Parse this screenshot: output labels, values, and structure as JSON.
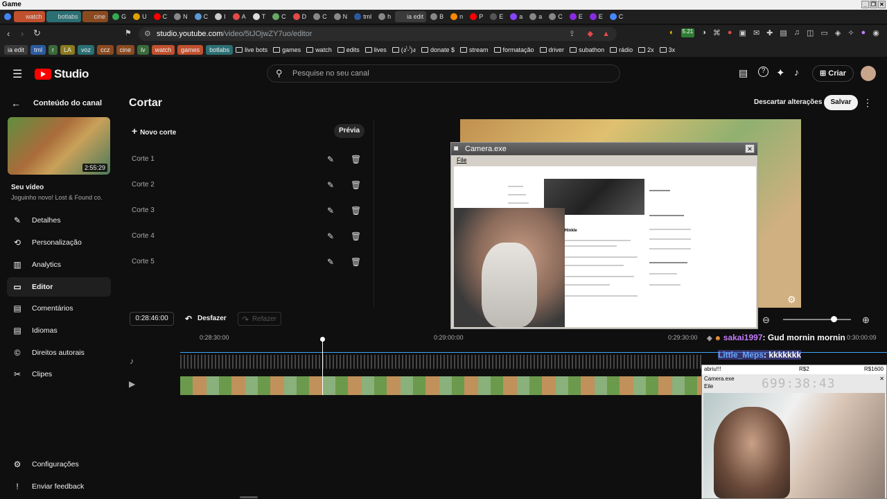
{
  "window": {
    "title": "Game",
    "controls": [
      "_",
      "❐",
      "✕"
    ]
  },
  "tabs": [
    {
      "label": "watch",
      "color": "#c0502e"
    },
    {
      "label": "botlabs",
      "color": "#2b6f73"
    },
    {
      "label": "cine",
      "color": "#8a4a20"
    },
    {
      "label": "G",
      "color": "#34a853"
    },
    {
      "label": "U",
      "color": "#e0a000"
    },
    {
      "label": "C",
      "color": "#ff0000"
    },
    {
      "label": "N",
      "color": "#888888"
    },
    {
      "label": "C",
      "color": "#5a9bd5"
    },
    {
      "label": "I",
      "color": "#cccccc"
    },
    {
      "label": "A",
      "color": "#e24a4a"
    },
    {
      "label": "T",
      "color": "#dddddd"
    },
    {
      "label": "C",
      "color": "#66aa66"
    },
    {
      "label": "D",
      "color": "#e24a4a"
    },
    {
      "label": "C",
      "color": "#888888"
    },
    {
      "label": "N",
      "color": "#888888"
    },
    {
      "label": "tml",
      "color": "#2c5aa0"
    },
    {
      "label": "h",
      "color": "#888888"
    },
    {
      "label": "ia edit",
      "color": "#3a3a3a"
    },
    {
      "label": "B",
      "color": "#888888"
    },
    {
      "label": "n",
      "color": "#ff8800"
    },
    {
      "label": "P",
      "color": "#ff0000"
    },
    {
      "label": "E",
      "color": "#555555"
    },
    {
      "label": "a",
      "color": "#8844ff"
    },
    {
      "label": "a",
      "color": "#888888"
    },
    {
      "label": "C",
      "color": "#888888"
    },
    {
      "label": "E",
      "color": "#8a2be2"
    },
    {
      "label": "E",
      "color": "#8a2be2"
    },
    {
      "label": "C",
      "color": "#4488ff"
    }
  ],
  "address": {
    "host": "studio.youtube.com",
    "path": "/video/5tJOjwZY7uo/editor"
  },
  "bookmarks": {
    "pills": [
      {
        "label": "ia edit",
        "color": "#3a3a3a"
      },
      {
        "label": "tml",
        "color": "#2c5aa0"
      },
      {
        "label": "r",
        "color": "#3a6a3a"
      },
      {
        "label": "LA",
        "color": "#8a7a20"
      },
      {
        "label": "voz",
        "color": "#2b6f73"
      },
      {
        "label": "ccz",
        "color": "#8a4a20"
      },
      {
        "label": "cine",
        "color": "#8a4a20"
      },
      {
        "label": "lv",
        "color": "#3a6a3a"
      },
      {
        "label": "watch",
        "color": "#c0502e"
      },
      {
        "label": "games",
        "color": "#c0502e"
      },
      {
        "label": "botlabs",
        "color": "#2b6f73"
      }
    ],
    "folders": [
      "live bots",
      "games",
      "watch",
      "edits",
      "lives",
      "(ง'̀-'́)ง",
      "donate $",
      "stream",
      "formatação",
      "driver",
      "subathon",
      "rádio",
      "2x",
      "3x"
    ]
  },
  "studio": {
    "brand": "Studio",
    "search_placeholder": "Pesquise no seu canal",
    "create_label": "Criar"
  },
  "sidebar": {
    "back_label": "Conteúdo do canal",
    "thumb_duration": "2:55:29",
    "your_video": "Seu vídeo",
    "video_title": "Joguinho novo! Lost & Found co.",
    "items": [
      {
        "label": "Detalhes",
        "icon": "✎"
      },
      {
        "label": "Personalização",
        "icon": "⟲"
      },
      {
        "label": "Analytics",
        "icon": "▥"
      },
      {
        "label": "Editor",
        "icon": "▭"
      },
      {
        "label": "Comentários",
        "icon": "▤"
      },
      {
        "label": "Idiomas",
        "icon": "▤"
      },
      {
        "label": "Direitos autorais",
        "icon": "©"
      },
      {
        "label": "Clipes",
        "icon": "✂"
      }
    ],
    "footer": [
      {
        "label": "Configurações",
        "icon": "⚙"
      },
      {
        "label": "Enviar feedback",
        "icon": "!"
      }
    ]
  },
  "editor": {
    "title": "Cortar",
    "discard_label": "Descartar alterações",
    "save_label": "Salvar",
    "new_cut_label": "Novo corte",
    "preview_label": "Prévia",
    "cuts": [
      "Corte 1",
      "Corte 2",
      "Corte 3",
      "Corte 4",
      "Corte 5"
    ],
    "timecode": "0:28:46:00",
    "undo_label": "Desfazer",
    "redo_label": "Refazer",
    "ticks": [
      "0:28:30:00",
      "0:29:00:00",
      "0:29:30:00",
      "0:30:00:09"
    ]
  },
  "camera": {
    "title": "Camera.exe",
    "menu_file": "File",
    "profile_name": "Jackson Hinkle"
  },
  "chat": [
    {
      "user": "sakai1997",
      "message": ": Gud mornin mornin"
    },
    {
      "user": "Little_Meps",
      "message": ": kkkkkkk"
    }
  ],
  "camera2": {
    "bar_left": "abriu!!!",
    "bar_mid": "R$2",
    "bar_right": "R$1600",
    "title": "Camera.exe",
    "menu_file": "Eile",
    "timer": "699:38:43"
  }
}
